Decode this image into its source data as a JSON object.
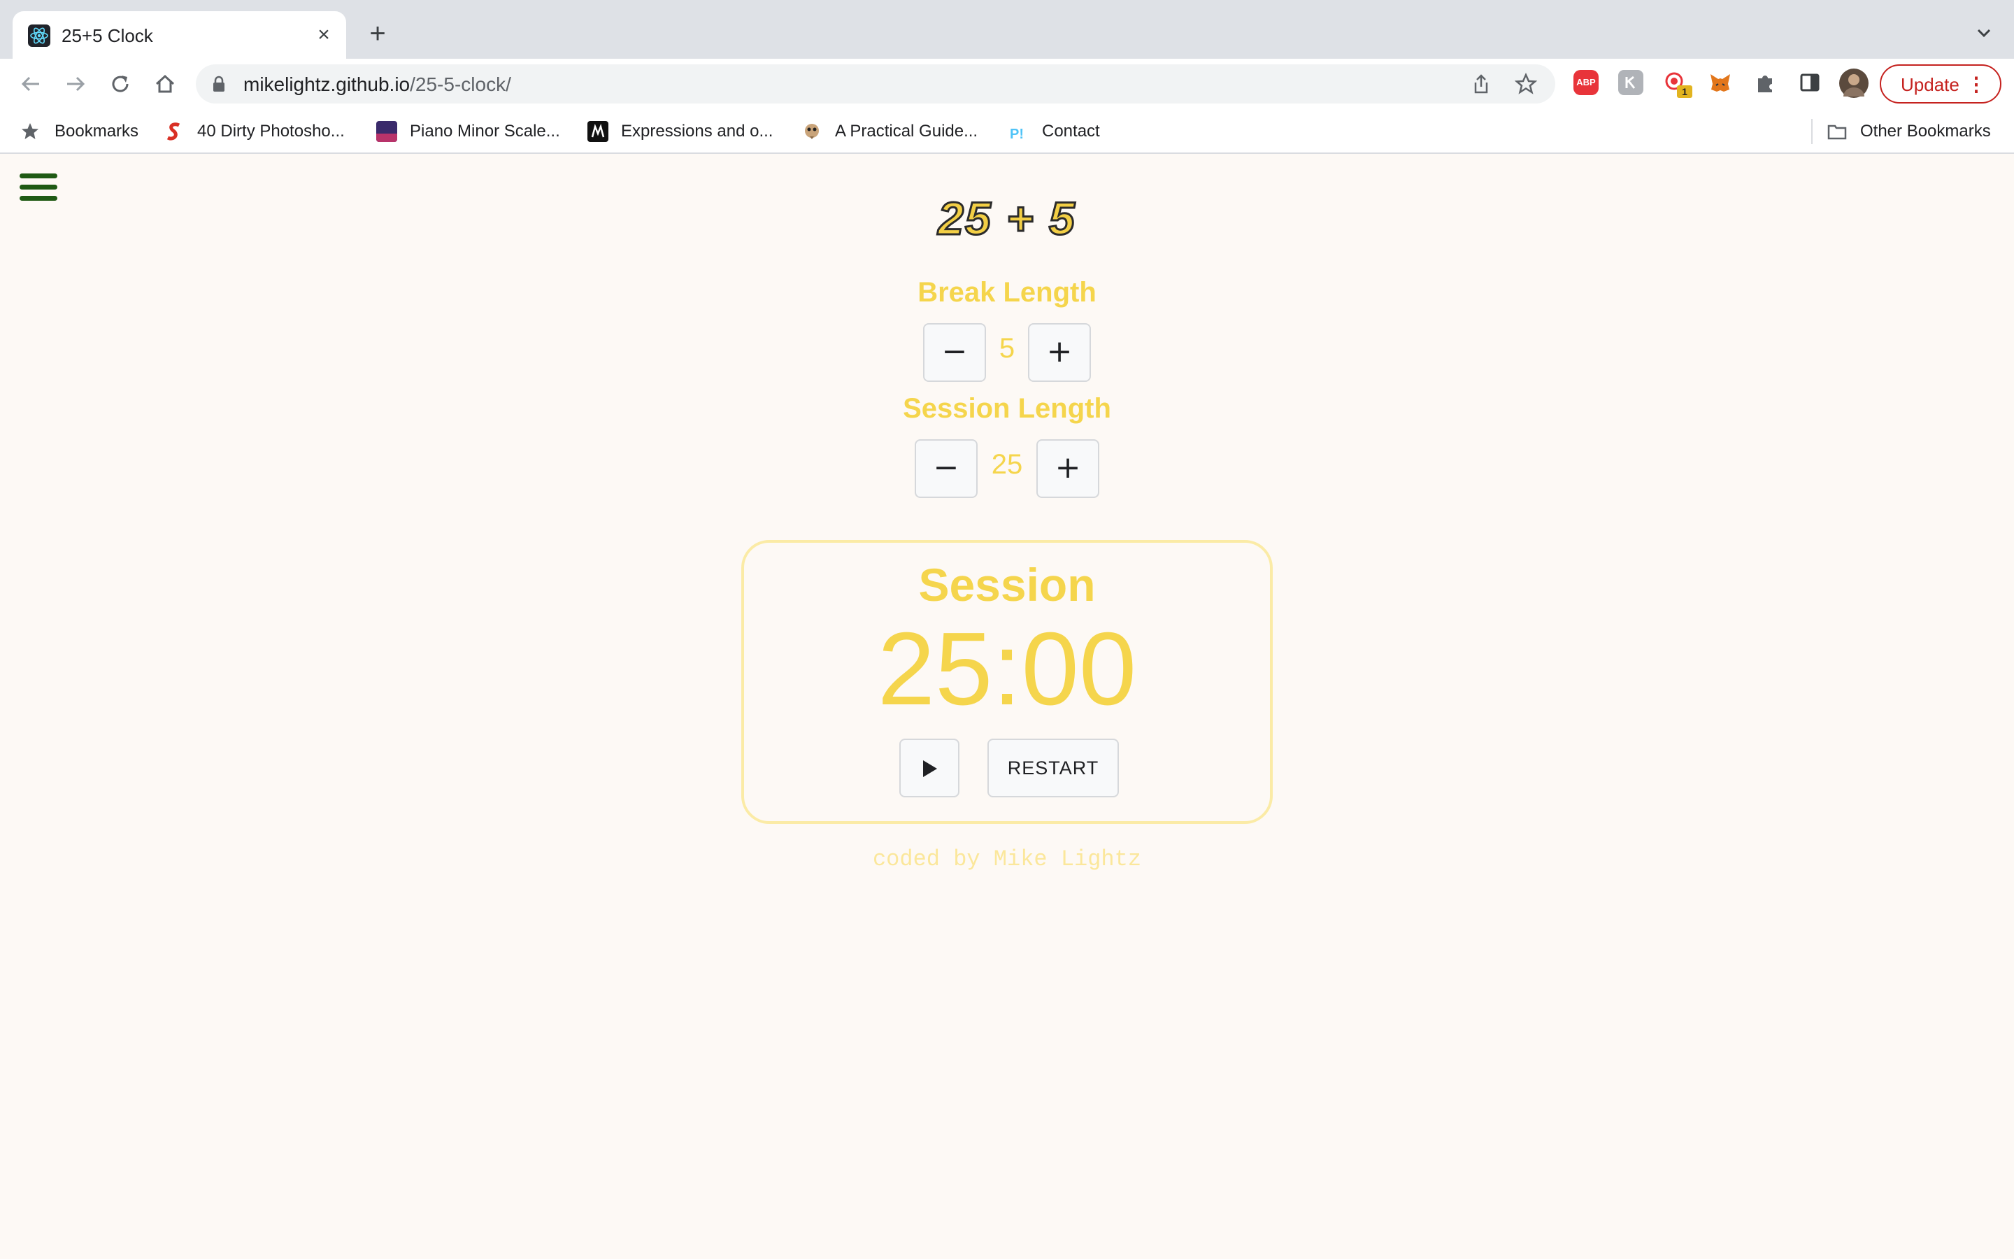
{
  "browser": {
    "tab": {
      "title": "25+5 Clock"
    },
    "url": {
      "domain": "mikelightz.github.io",
      "path": "/25-5-clock/"
    },
    "update_label": "Update",
    "ext_abp": "ABP",
    "ext_badge": "1",
    "bookmarks": [
      {
        "label": "Bookmarks",
        "icon": "star-icon"
      },
      {
        "label": "40 Dirty Photosho...",
        "icon": "s-logo-icon"
      },
      {
        "label": "Piano Minor Scale...",
        "icon": "piano-thumb-icon"
      },
      {
        "label": "Expressions and o...",
        "icon": "m-logo-icon"
      },
      {
        "label": "A Practical Guide...",
        "icon": "meerkat-icon"
      },
      {
        "label": "Contact",
        "icon": "p-logo-icon"
      }
    ],
    "other_bookmarks": "Other Bookmarks"
  },
  "app": {
    "title": "25 + 5",
    "break": {
      "label": "Break Length",
      "value": "5",
      "dec": "−",
      "inc": "+"
    },
    "session": {
      "label": "Session Length",
      "value": "25",
      "dec": "−",
      "inc": "+"
    },
    "timer": {
      "label": "Session",
      "time": "25:00",
      "restart_label": "RESTART"
    },
    "footer": "coded by Mike Lightz"
  },
  "colors": {
    "accent_yellow": "#f5d54c",
    "menu_green": "#1f5a14",
    "background": "#fdf9f5",
    "update_red": "#c5221f"
  }
}
